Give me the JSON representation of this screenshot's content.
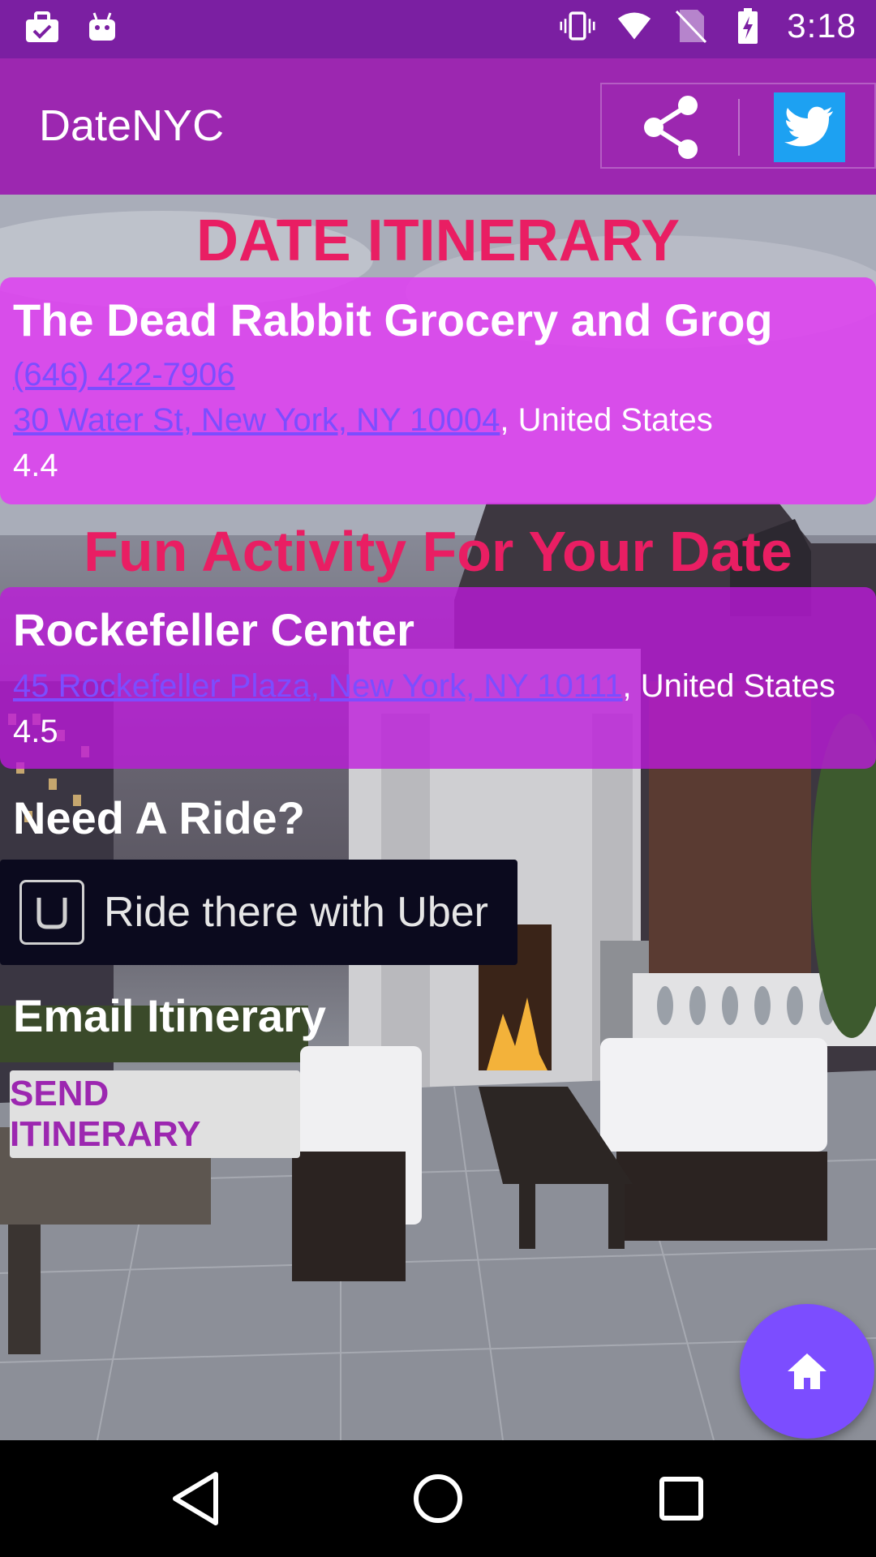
{
  "status_bar": {
    "time": "3:18",
    "left_icons": [
      "briefcase-check-icon",
      "android-icon"
    ],
    "right_icons": [
      "vibrate-icon",
      "wifi-icon",
      "no-sim-icon",
      "battery-charging-icon"
    ]
  },
  "app_bar": {
    "title": "DateNYC",
    "actions": [
      "share-icon",
      "twitter-icon"
    ]
  },
  "itinerary": {
    "heading": "DATE ITINERARY",
    "place": {
      "name": "The Dead Rabbit Grocery and Grog",
      "phone": "(646) 422-7906",
      "address_link": "30 Water St, New York, NY 10004",
      "address_suffix": ", United States",
      "rating": "4.4"
    }
  },
  "activity": {
    "heading": "Fun Activity For Your Date",
    "place": {
      "name": "Rockefeller Center",
      "address_link": "45 Rockefeller Plaza, New York, NY 10111",
      "address_suffix": ", United States",
      "rating": "4.5"
    }
  },
  "ride": {
    "label": "Need A Ride?",
    "uber_button": "Ride there with Uber"
  },
  "email": {
    "label": "Email Itinerary",
    "send_button": "SEND ITINERARY"
  },
  "fab": {
    "icon": "home-icon"
  },
  "nav_bar": {
    "items": [
      "back-icon",
      "home-circle-icon",
      "recents-icon"
    ]
  },
  "colors": {
    "status_bar": "#7b1fa2",
    "app_bar": "#9c27b0",
    "heading": "#e91e63",
    "link": "#7c4dff",
    "fab": "#7c4dff",
    "twitter": "#1da1f2"
  }
}
